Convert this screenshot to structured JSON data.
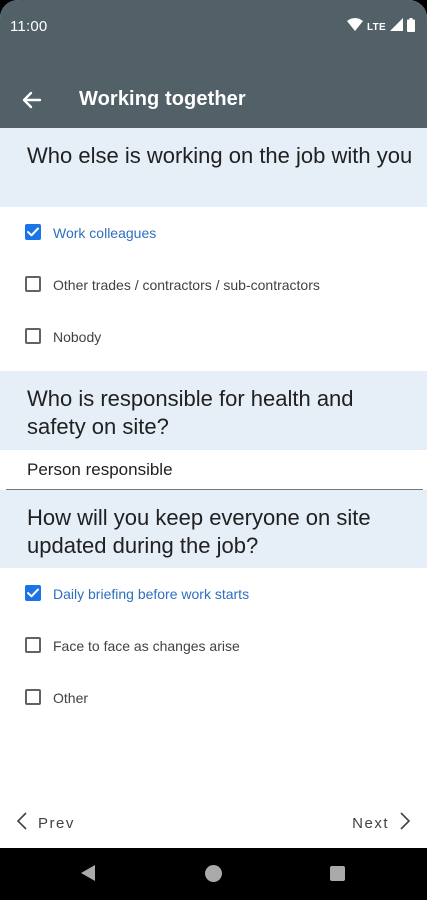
{
  "status_bar": {
    "time": "11:00",
    "network": "LTE"
  },
  "app_bar": {
    "title": "Working together",
    "back_icon": "arrow-back-icon"
  },
  "questions": [
    {
      "title": "Who else is working on the job with you",
      "options": [
        {
          "label": "Work colleagues",
          "checked": true
        },
        {
          "label": "Other trades / contractors / sub-contractors",
          "checked": false
        },
        {
          "label": "Nobody",
          "checked": false
        }
      ]
    },
    {
      "title": "Who is responsible for health and safety on site?",
      "input_placeholder": "Person responsible",
      "input_value": ""
    },
    {
      "title": "How will you keep everyone on site updated during the job?",
      "options": [
        {
          "label": "Daily briefing before work starts",
          "checked": true
        },
        {
          "label": "Face to face as changes arise",
          "checked": false
        },
        {
          "label": "Other",
          "checked": false
        }
      ]
    }
  ],
  "footer": {
    "prev_label": "Prev",
    "next_label": "Next"
  },
  "colors": {
    "app_bar": "#526068",
    "question_bg": "#e6eef7",
    "accent": "#1a73e8",
    "selected_text": "#2f6fbf"
  }
}
